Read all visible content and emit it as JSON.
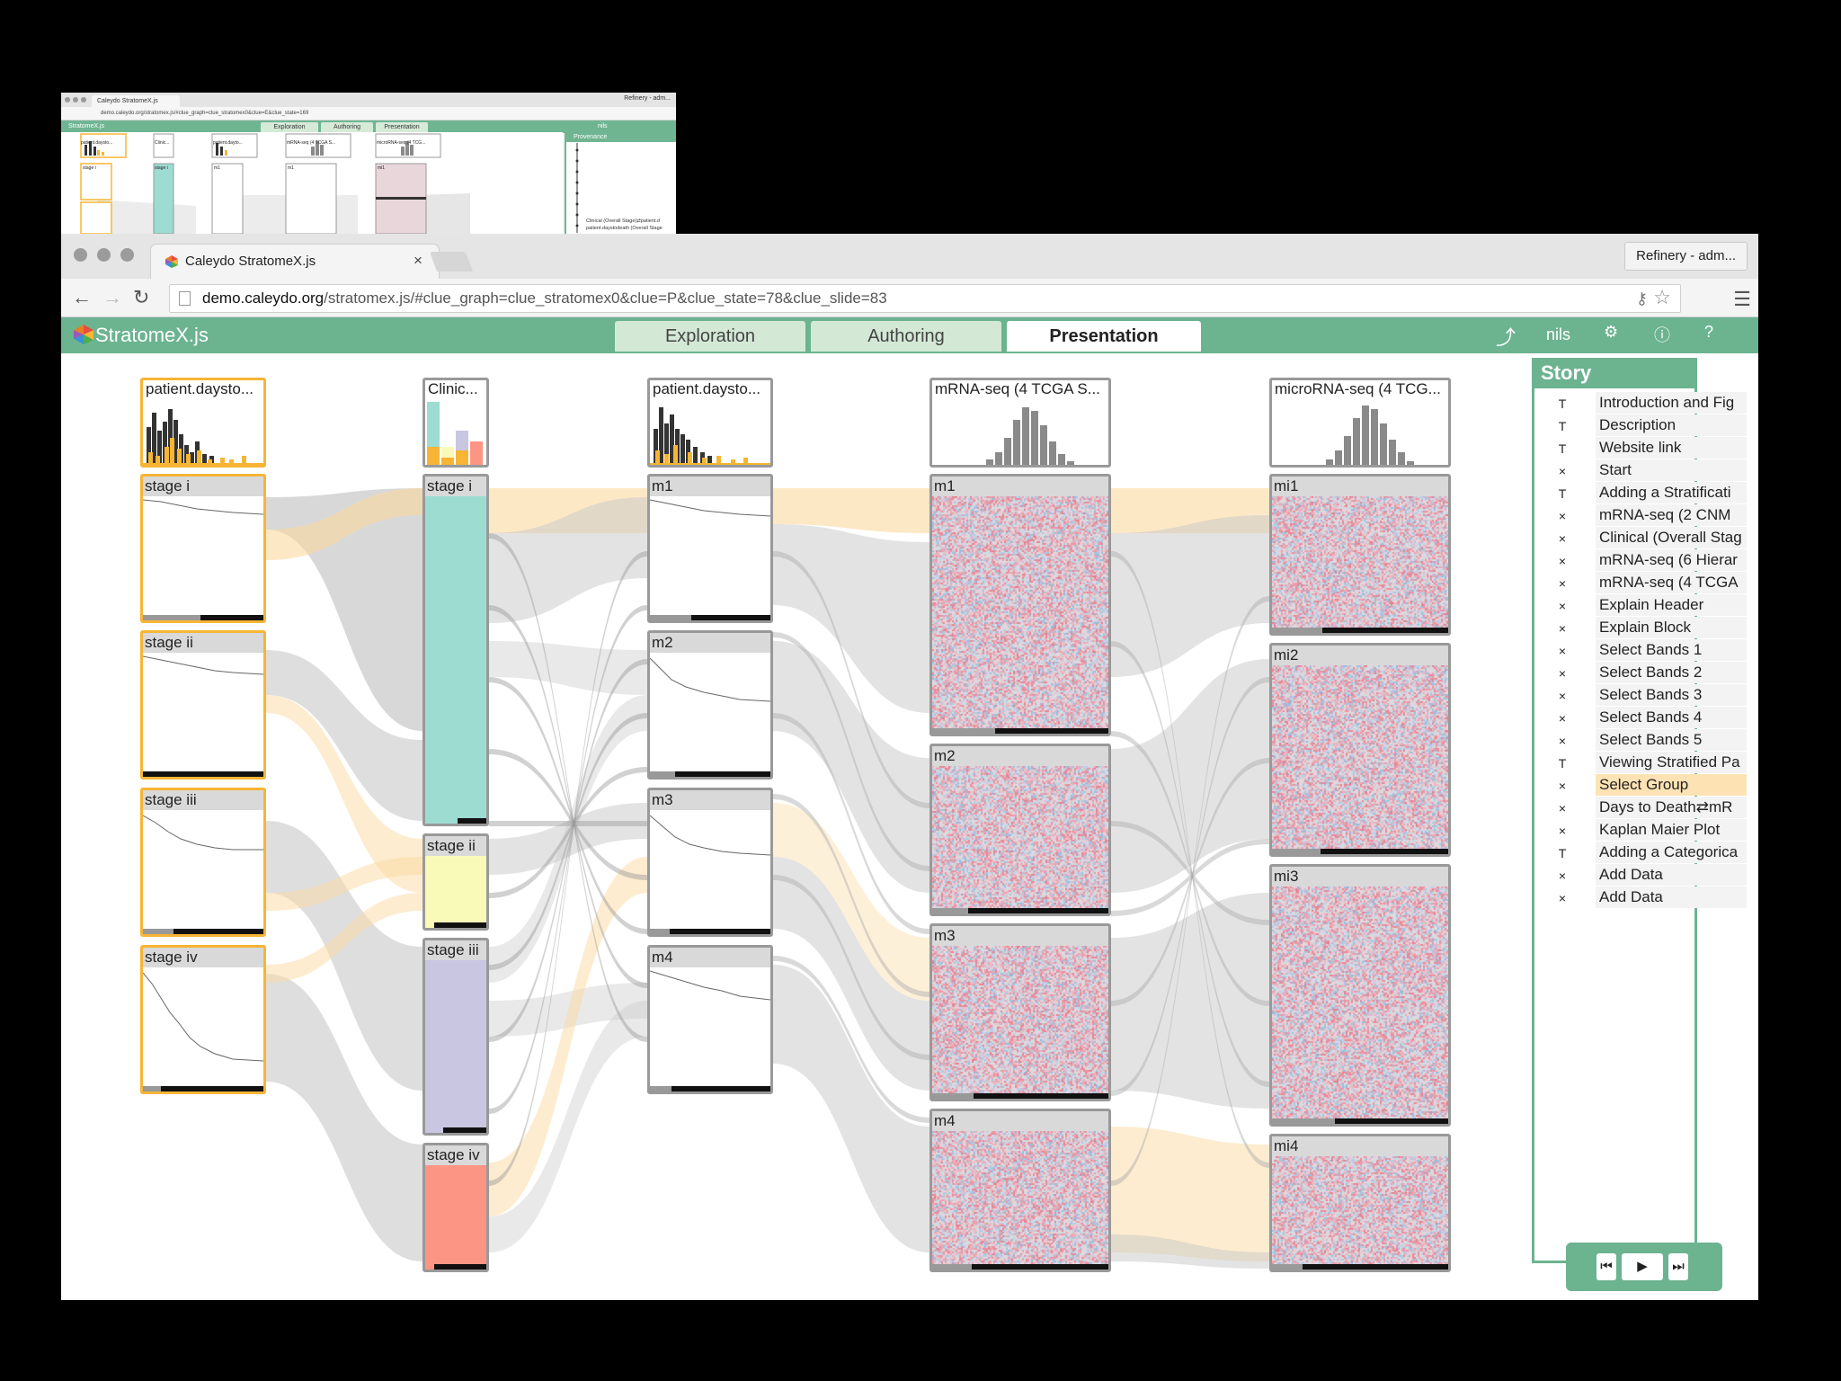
{
  "mini": {
    "tab_title": "Caleydo StratomeX.js",
    "profile": "Refinery - adm...",
    "url": "demo.caleydo.org/stratomex.js/#clue_graph=clue_stratomex0&clue=E&clue_state=169",
    "app_name": "StratomeX.js",
    "tabs": [
      "Exploration",
      "Authoring",
      "Presentation"
    ],
    "user": "nils",
    "provenance_title": "Provenance",
    "columns": [
      "patient.daysto...",
      "Clinic...",
      "patient.dayto...",
      "mRNA-seq (4 TCGA S...",
      "microRNA-seq (4 TCG..."
    ],
    "blocks": [
      "stage i",
      "stage i",
      "m1",
      "m1",
      "mi1"
    ],
    "prov_items": [
      "Clinical (Overall Stage)⇄patient.d",
      "patient.daystodeath (Overall Stage"
    ]
  },
  "browser": {
    "tab_title": "Caleydo StratomeX.js",
    "tab_close": "×",
    "profile": "Refinery - adm...",
    "url_host": "demo.caleydo.org",
    "url_path": "/stratomex.js/#clue_graph=clue_stratomex0&clue=P&clue_state=78&clue_slide=83",
    "back": "←",
    "forward": "→",
    "reload": "↻",
    "menu": "☰"
  },
  "app": {
    "name": "StratomeX.js",
    "tabs": [
      "Exploration",
      "Authoring",
      "Presentation"
    ],
    "active_tab": "Presentation",
    "user": "nils",
    "accent": "#6cb390"
  },
  "columns": [
    {
      "header": "patient.daysto...",
      "selected": true,
      "blocks": [
        "stage i",
        "stage ii",
        "stage iii",
        "stage iv"
      ]
    },
    {
      "header": "Clinic...",
      "selected": false,
      "blocks": [
        "stage i",
        "stage ii",
        "stage iii",
        "stage iv"
      ]
    },
    {
      "header": "patient.daysto...",
      "selected": false,
      "blocks": [
        "m1",
        "m2",
        "m3",
        "m4"
      ]
    },
    {
      "header": "mRNA-seq (4 TCGA S...",
      "selected": false,
      "blocks": [
        "m1",
        "m2",
        "m3",
        "m4"
      ]
    },
    {
      "header": "microRNA-seq (4 TCG...",
      "selected": false,
      "blocks": [
        "mi1",
        "mi2",
        "mi3",
        "mi4"
      ]
    }
  ],
  "stage_colors": {
    "stage i": "#9cdcd1",
    "stage ii": "#fafab8",
    "stage iii": "#c8c6e0",
    "stage iv": "#fd9584"
  },
  "story": {
    "title": "Story",
    "items": [
      {
        "icon": "T",
        "label": "Introduction and Fig"
      },
      {
        "icon": "T",
        "label": "Description"
      },
      {
        "icon": "T",
        "label": "Website link"
      },
      {
        "icon": "×",
        "label": "Start"
      },
      {
        "icon": "T",
        "label": "Adding a Stratificati"
      },
      {
        "icon": "×",
        "label": "mRNA-seq (2 CNM"
      },
      {
        "icon": "×",
        "label": "Clinical (Overall Stag"
      },
      {
        "icon": "×",
        "label": "mRNA-seq (6 Hierar"
      },
      {
        "icon": "×",
        "label": "mRNA-seq (4 TCGA"
      },
      {
        "icon": "×",
        "label": "Explain Header"
      },
      {
        "icon": "×",
        "label": "Explain Block"
      },
      {
        "icon": "×",
        "label": "Select Bands 1"
      },
      {
        "icon": "×",
        "label": "Select Bands 2"
      },
      {
        "icon": "×",
        "label": "Select Bands 3"
      },
      {
        "icon": "×",
        "label": "Select Bands 4"
      },
      {
        "icon": "×",
        "label": "Select Bands 5"
      },
      {
        "icon": "T",
        "label": "Viewing Stratified Pa"
      },
      {
        "icon": "×",
        "label": "Select Group",
        "selected": true
      },
      {
        "icon": "×",
        "label": "Days to Death⇄mR"
      },
      {
        "icon": "×",
        "label": "Kaplan Maier Plot"
      },
      {
        "icon": "T",
        "label": "Adding a Categorica"
      },
      {
        "icon": "×",
        "label": "Add Data"
      },
      {
        "icon": "×",
        "label": "Add Data"
      }
    ],
    "player": {
      "prev": "⏮",
      "play": "▶",
      "next": "⏭"
    }
  }
}
